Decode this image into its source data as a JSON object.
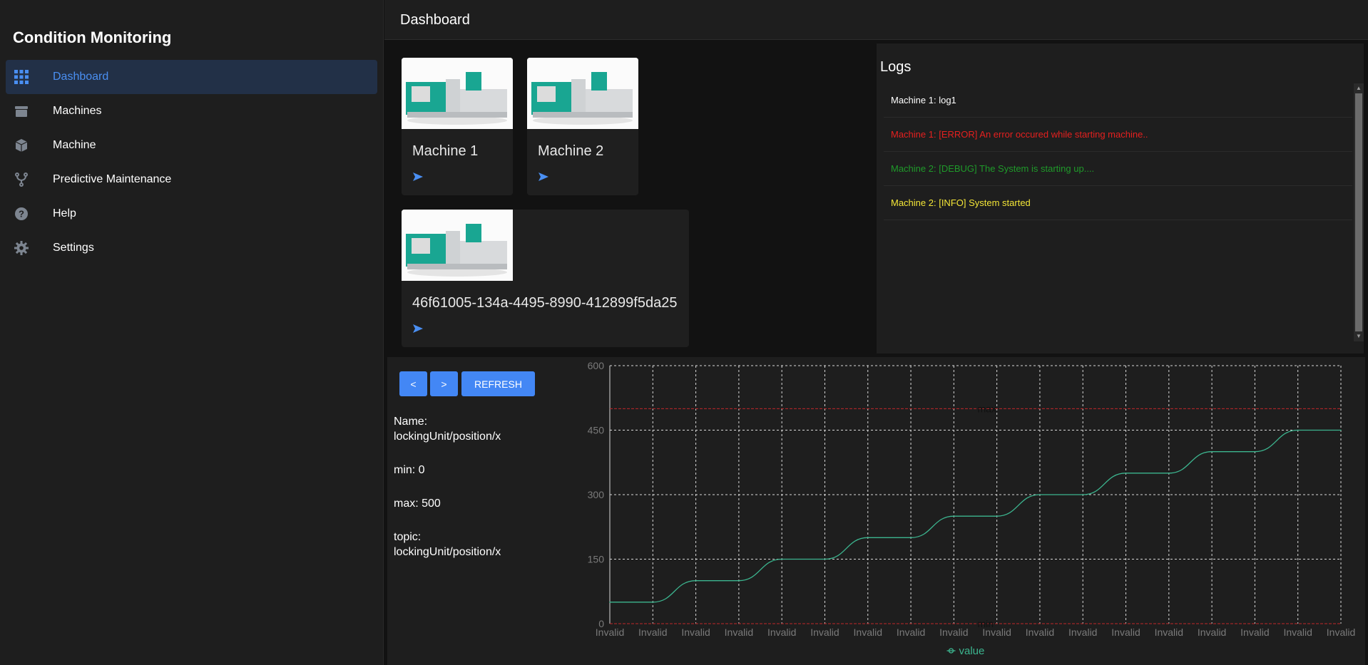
{
  "sidebar": {
    "brand": "Condition Monitoring",
    "items": [
      {
        "label": "Dashboard",
        "icon": "grid-icon",
        "active": true
      },
      {
        "label": "Machines",
        "icon": "machines-icon"
      },
      {
        "label": "Machine",
        "icon": "cube-icon"
      },
      {
        "label": "Predictive Maintenance",
        "icon": "branch-icon"
      },
      {
        "label": "Help",
        "icon": "help-icon"
      },
      {
        "label": "Settings",
        "icon": "gear-icon"
      }
    ]
  },
  "header": {
    "title": "Dashboard"
  },
  "machines": [
    {
      "name": "Machine 1"
    },
    {
      "name": "Machine 2"
    },
    {
      "name": "46f61005-134a-4495-8990-412899f5da25"
    }
  ],
  "logs": {
    "title": "Logs",
    "entries": [
      {
        "text": "Machine 1: log1",
        "color": "#ffffff"
      },
      {
        "text": "Machine 1: [ERROR] An error occured while starting machine..",
        "color": "#e5201f"
      },
      {
        "text": "Machine 2: [DEBUG] The System is starting up....",
        "color": "#1f9a2a"
      },
      {
        "text": "Machine 2: [INFO] System started",
        "color": "#f4e637"
      }
    ]
  },
  "controls": {
    "prev_label": "<",
    "next_label": ">",
    "refresh_label": "REFRESH"
  },
  "info": {
    "name_label": "Name:",
    "name_value": "lockingUnit/position/x",
    "min_text": "min: 0",
    "max_text": "max: 500",
    "topic_label": "topic:",
    "topic_value": "lockingUnit/position/x"
  },
  "chart_data": {
    "type": "line",
    "categories": [
      "Invalid",
      "Invalid",
      "Invalid",
      "Invalid",
      "Invalid",
      "Invalid",
      "Invalid",
      "Invalid",
      "Invalid",
      "Invalid",
      "Invalid",
      "Invalid",
      "Invalid",
      "Invalid",
      "Invalid",
      "Invalid",
      "Invalid",
      "Invalid"
    ],
    "series": [
      {
        "name": "value",
        "color": "#3cb58f",
        "values": [
          50,
          50,
          100,
          100,
          150,
          150,
          200,
          200,
          250,
          250,
          300,
          300,
          350,
          350,
          400,
          400,
          450,
          450
        ]
      }
    ],
    "ylim": [
      0,
      600
    ],
    "yticks": [
      0,
      150,
      300,
      450,
      600
    ],
    "thresholds": [
      {
        "label": "max",
        "value": 500,
        "color": "#c0282a"
      },
      {
        "label": "min",
        "value": 0,
        "color": "#c0282a"
      }
    ],
    "grid": true,
    "legend": "bottom"
  },
  "colors": {
    "accent": "#4387f5",
    "active_bg": "#223047",
    "line": "#3cb58f"
  }
}
